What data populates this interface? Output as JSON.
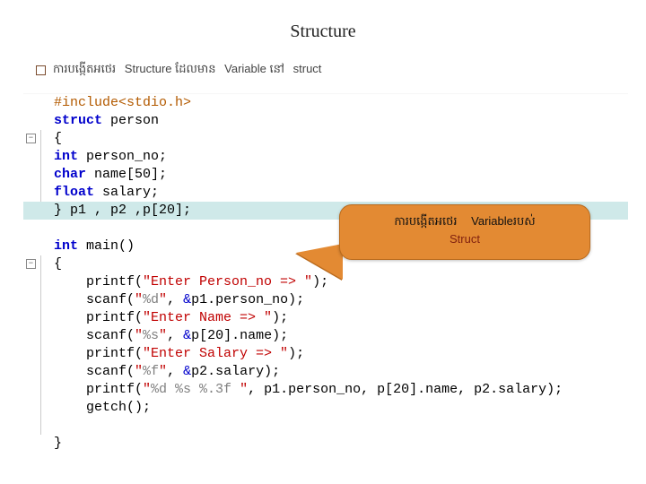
{
  "title": "Structure",
  "bullet": {
    "t1": "ការបង្កើតអថេរ",
    "t2": "Structure ដែលមាន",
    "t3": "Variable នៅ",
    "t4": "struct"
  },
  "code": {
    "l0": "#include<stdio.h>",
    "l1a": "struct",
    "l1b": " person",
    "l2": "{",
    "l3a": "int",
    "l3b": " person_no;",
    "l4a": "char",
    "l4b": " name[50];",
    "l5a": "float",
    "l5b": " salary;",
    "l6": "} p1 , p2 ,p[20];",
    "l8a": "int",
    "l8b": " main()",
    "l9": "{",
    "p1a": "    printf(",
    "p1b": "\"Enter Person_no => \"",
    "p1c": ");",
    "s1a": "    scanf(",
    "s1b": "\"",
    "s1c": "%d",
    "s1d": "\"",
    "s1e": ", ",
    "s1f": "&",
    "s1g": "p1.person_no);",
    "p2a": "    printf(",
    "p2b": "\"Enter Name => \"",
    "p2c": ");",
    "s2a": "    scanf(",
    "s2b": "\"",
    "s2c": "%s",
    "s2d": "\"",
    "s2e": ", ",
    "s2f": "&",
    "s2g": "p[20].name);",
    "p3a": "    printf(",
    "p3b": "\"Enter Salary => \"",
    "p3c": ");",
    "s3a": "    scanf(",
    "s3b": "\"",
    "s3c": "%f",
    "s3d": "\"",
    "s3e": ", ",
    "s3f": "&",
    "s3g": "p2.salary);",
    "p4a": "    printf(",
    "p4b": "\"",
    "p4c": "%d %s %.3f ",
    "p4d": "\"",
    "p4e": ", p1.person_no, p[20].name, p2.salary);",
    "g1": "    getch();",
    "end": "}"
  },
  "callout": {
    "a": "ការបង្កើតអថេរ",
    "b": "Variableរបស់",
    "c": "Struct"
  }
}
